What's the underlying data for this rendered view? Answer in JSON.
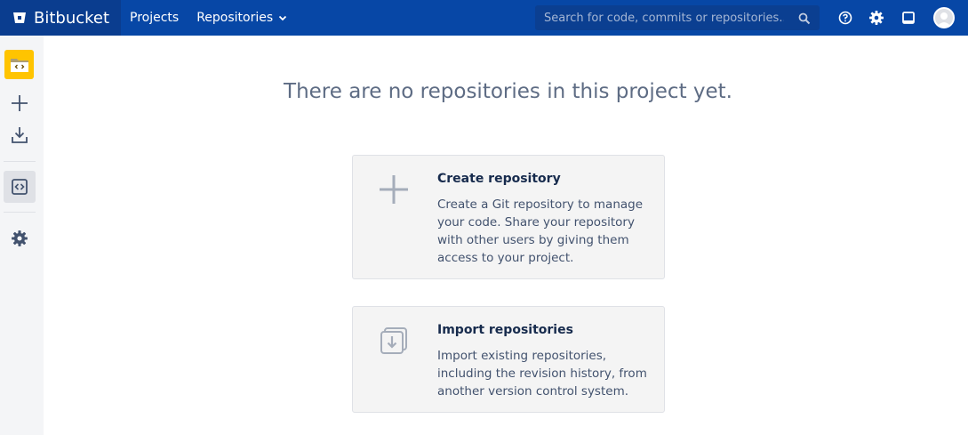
{
  "nav": {
    "brand": "Bitbucket",
    "projects": "Projects",
    "repositories": "Repositories",
    "search_placeholder": "Search for code, commits or repositories..."
  },
  "icons": {
    "brand": "bitbucket-logo-icon",
    "search": "search-icon",
    "help": "help-icon",
    "settings": "gear-icon",
    "apps": "square-icon",
    "avatar": "user-avatar-icon"
  },
  "sidebar": {
    "items": [
      {
        "name": "project-avatar",
        "icon": "folder-code-icon"
      },
      {
        "name": "create",
        "icon": "plus-icon"
      },
      {
        "name": "import",
        "icon": "download-icon"
      },
      {
        "name": "repositories",
        "icon": "code-icon"
      },
      {
        "name": "settings",
        "icon": "gear-icon"
      }
    ]
  },
  "main": {
    "heading": "There are no repositories in this project yet.",
    "cards": [
      {
        "title": "Create repository",
        "description": "Create a Git repository to manage your code. Share your repository with other users by giving them access to your project."
      },
      {
        "title": "Import repositories",
        "description": "Import existing repositories, including the revision history, from another version control system."
      }
    ]
  },
  "colors": {
    "topbar": "#0747a6",
    "brand_bg": "#0a3d8f",
    "sidebar_bg": "#f4f5f7",
    "project_avatar": "#ffc400",
    "card_bg": "#f4f4f4",
    "heading_text": "#5e6c84"
  }
}
